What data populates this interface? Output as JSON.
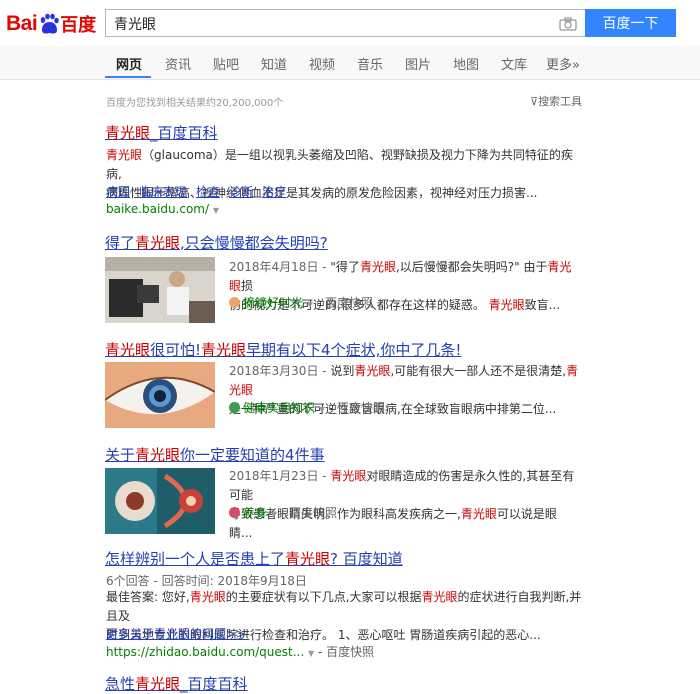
{
  "header": {
    "logo_en": "Bai",
    "logo_du": "du",
    "logo_cn": "百度",
    "query": "青光眼",
    "search_button": "百度一下"
  },
  "tabs": [
    "网页",
    "资讯",
    "贴吧",
    "知道",
    "视频",
    "音乐",
    "图片",
    "地图",
    "文库",
    "更多»"
  ],
  "stats": "百度为您找到相关结果约20,200,000个",
  "tools": "搜索工具",
  "results": [
    {
      "title_hl": "青光眼",
      "title_rest": "_百度百科",
      "abs_hl": "青光眼",
      "abs_line1": "（glaucoma）是一组以视乳头萎缩及凹陷、视野缺损及视力下降为共同特征的疾病,",
      "abs_line2": "病理性眼压增高、视神经供血不足是其发病的原发危险因素，视神经对压力损害...",
      "links": [
        "病因",
        "临床表现",
        "检查",
        "诊断",
        "治疗"
      ],
      "url": "baike.baidu.com/"
    },
    {
      "title_a": "得了",
      "title_hl": "青光眼",
      "title_b": ",只会慢慢都会失明吗?",
      "date": "2018年4月18日 - ",
      "abs1_a": "\"得了",
      "abs1_hl": "青光眼",
      "abs1_b": ",以后慢慢都会失明吗?\" 由于",
      "abs1_hl2": "青光眼",
      "abs1_c": "损",
      "abs2_a": "伤的视力是不可逆的,很多人都存在这样的疑惑。",
      "abs2_hl": "青光眼",
      "abs2_b": "致盲...",
      "source": "摘镜好时光",
      "cache": "百度快照"
    },
    {
      "title_hl": "青光眼",
      "title_a": "很可怕!",
      "title_hl2": "青光眼",
      "title_b": "早期有以下4个症状,你中了几条!",
      "date": "2018年3月30日 - ",
      "abs1_a": "说到",
      "abs1_hl": "青光眼",
      "abs1_b": ",可能有很大一部人还不是很清楚,",
      "abs1_hl2": "青光眼",
      "abs2": "是一种严重的不可逆性致盲眼病,在全球致盲眼病中排第二位...",
      "source": "健康实用知识",
      "cache": "百度快照"
    },
    {
      "title_a": "关于",
      "title_hl": "青光眼",
      "title_b": "你一定要知道的4件事",
      "date": "2018年1月23日 - ",
      "abs1_hl": "青光眼",
      "abs1_b": "对眼睛造成的伤害是永久性的,其甚至有可能",
      "abs2_a": "导致患者眼睛失明。作为眼科高发疾病之一,",
      "abs2_hl": "青光眼",
      "abs2_b": "可以说是眼睛...",
      "source": "养身",
      "cache": "百度快照"
    },
    {
      "title_a": "怎样辨别一个人是否患上了",
      "title_hl": "青光眼",
      "title_b": "? 百度知道",
      "meta": "6个回答 - 回答时间: 2018年9月18日",
      "abs1_a": "最佳答案: 您好,",
      "abs1_hl": "青光眼",
      "abs1_b": "的主要症状有以下几点,大家可以根据",
      "abs1_hl2": "青光眼",
      "abs1_c": "的症状进行自我判断,并且及",
      "abs2": "时到当地专业的眼科医院进行检查和治疗。 1、恶心呕吐 胃肠道疾病引起的恶心...",
      "more": "更多关于青光眼的问题>>",
      "url": "https://zhidao.baidu.com/quest...",
      "cache": "百度快照"
    },
    {
      "title_a": "急性",
      "title_hl": "青光眼",
      "title_b": "_百度百科"
    }
  ],
  "colors": {
    "link": "#2440b3",
    "highlight": "#cc0000",
    "url": "#008000",
    "button": "#3385ff"
  }
}
